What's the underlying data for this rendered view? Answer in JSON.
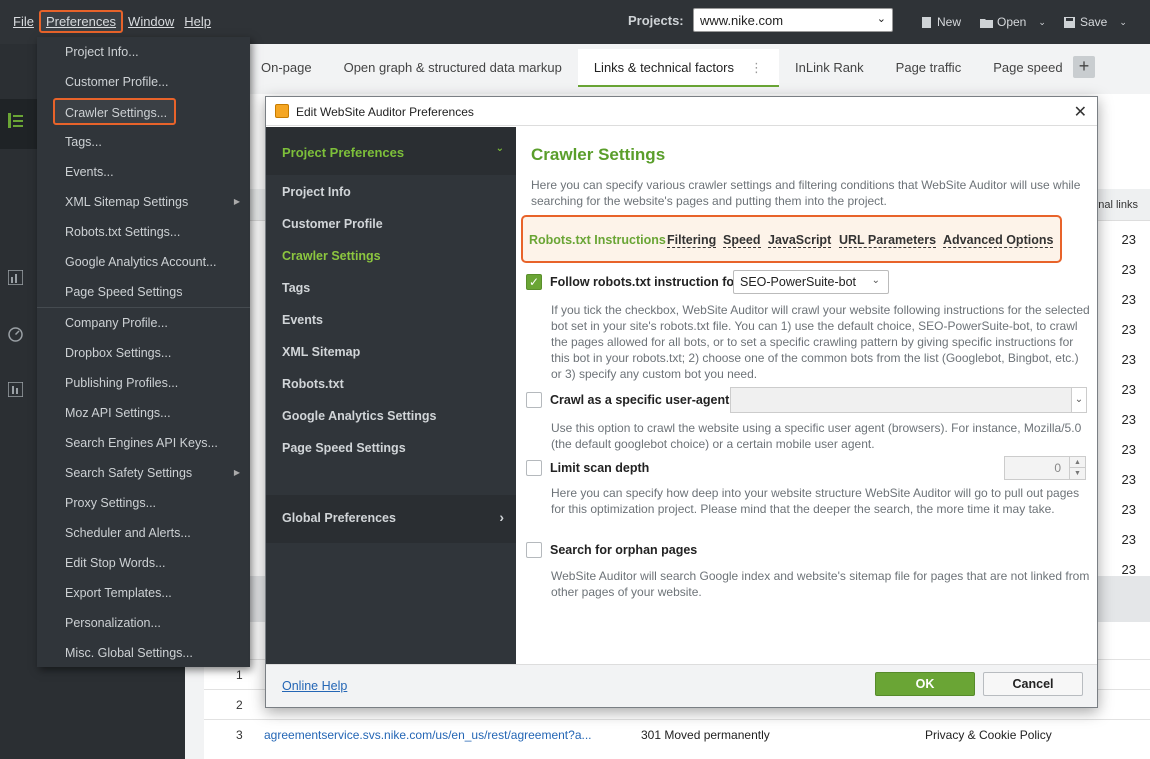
{
  "topbar": {
    "menu": [
      "File",
      "Preferences",
      "Window",
      "Help"
    ],
    "projects_label": "Projects:",
    "project_value": "www.nike.com",
    "new_label": "New",
    "open_label": "Open",
    "save_label": "Save"
  },
  "main": {
    "tabs": [
      "On-page",
      "Open graph & structured data markup",
      "Links & technical factors",
      "InLink Rank",
      "Page traffic",
      "Page speed"
    ],
    "column_header": "ernal links",
    "values": [
      "23",
      "23",
      "23",
      "23",
      "23",
      "23",
      "23",
      "23",
      "23",
      "23",
      "23",
      "23"
    ],
    "rows": [
      {
        "n": "1",
        "url": "",
        "status": "",
        "title": ""
      },
      {
        "n": "2",
        "url": "",
        "status": "",
        "title": ""
      },
      {
        "n": "3",
        "url": "agreementservice.svs.nike.com/us/en_us/rest/agreement?a...",
        "status": "301 Moved permanently",
        "title": "Privacy & Cookie Policy"
      }
    ]
  },
  "prefmenu": {
    "items": [
      "Project Info...",
      "Customer Profile...",
      "Crawler Settings...",
      "Tags...",
      "Events...",
      "XML Sitemap Settings",
      "Robots.txt Settings...",
      "Google Analytics Account...",
      "Page Speed Settings",
      "Company Profile...",
      "Dropbox Settings...",
      "Publishing Profiles...",
      "Moz API Settings...",
      "Search Engines API Keys...",
      "Search Safety Settings",
      "Proxy Settings...",
      "Scheduler and Alerts...",
      "Edit Stop Words...",
      "Export Templates...",
      "Personalization...",
      "Misc. Global Settings..."
    ]
  },
  "dialog": {
    "title": "Edit WebSite Auditor Preferences",
    "nav_head": "Project Preferences",
    "nav_items": [
      "Project Info",
      "Customer Profile",
      "Crawler Settings",
      "Tags",
      "Events",
      "XML Sitemap",
      "Robots.txt",
      "Google Analytics Settings",
      "Page Speed Settings"
    ],
    "nav_foot": "Global Preferences",
    "body_title": "Crawler Settings",
    "body_desc": "Here you can specify various crawler settings and filtering conditions that WebSite Auditor will use while searching for the website's pages and putting them into the project.",
    "subtabs": [
      "Robots.txt Instructions",
      "Filtering",
      "Speed",
      "JavaScript",
      "URL Parameters",
      "Advanced Options"
    ],
    "opt1_label": "Follow robots.txt instruction for",
    "opt1_select": "SEO-PowerSuite-bot",
    "opt1_desc": "If you tick the checkbox, WebSite Auditor will crawl your website following instructions for the selected bot set in your site's robots.txt file. You can 1) use the default choice, SEO-PowerSuite-bot, to crawl the pages allowed for all bots, or to set a specific crawling pattern by giving specific instructions for this bot in your robots.txt; 2) choose one of the common bots from the list (Googlebot, Bingbot, etc.) or 3) specify any custom bot you need.",
    "opt2_label": "Crawl as a specific user-agent",
    "opt2_desc": "Use this option to crawl the website using a specific user agent (browsers). For instance, Mozilla/5.0 (the default googlebot choice) or a certain mobile user agent.",
    "opt3_label": "Limit scan depth",
    "opt3_value": "0",
    "opt3_desc": "Here you can specify how deep into your website structure WebSite Auditor will go to pull out pages for this optimization project. Please mind that the deeper the search, the more time it may take.",
    "opt4_label": "Search for orphan pages",
    "opt4_desc": "WebSite Auditor will search Google index and website's sitemap file for pages that are not linked from other pages of your website.",
    "help_link": "Online Help",
    "ok": "OK",
    "cancel": "Cancel"
  },
  "colors": {
    "accent_green": "#6aa535",
    "highlight_orange": "#e8632a"
  }
}
